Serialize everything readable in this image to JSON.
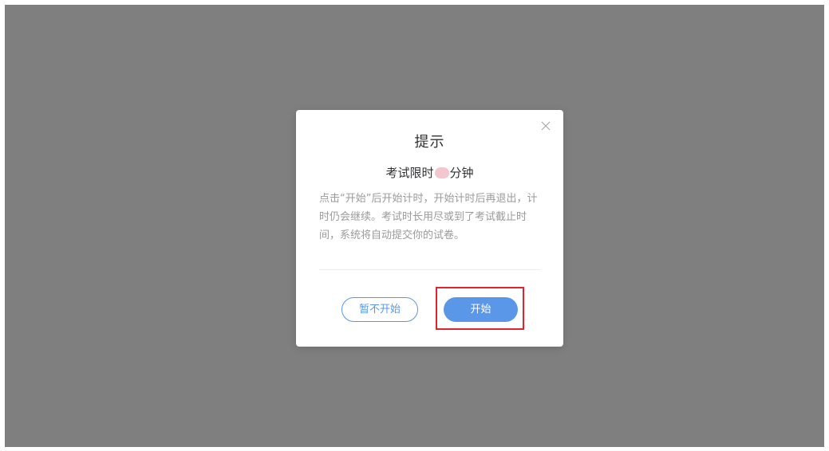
{
  "dialog": {
    "title": "提示",
    "subtitle_prefix": "考试限时",
    "subtitle_suffix": "分钟",
    "description": "点击“开始”后开始计时，开始计时后再退出，计时仍会继续。考试时长用尽或到了考试截止时间，系统将自动提交你的试卷。",
    "close_icon": "close-icon",
    "cancel_label": "暂不开始",
    "start_label": "开始"
  },
  "colors": {
    "overlay": "#7f7f7f",
    "primary": "#5b97e8",
    "highlight": "#e0242f",
    "redaction": "#f4c6cf"
  }
}
